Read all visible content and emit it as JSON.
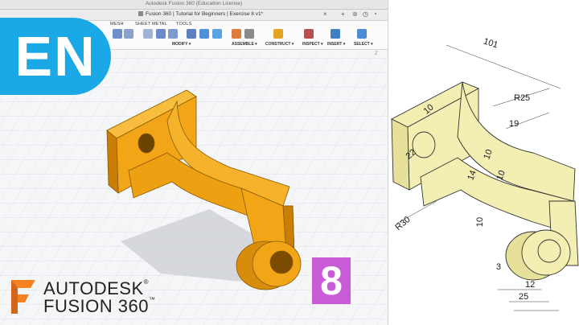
{
  "window": {
    "mac_title": "Autodesk Fusion 360 (Education License)",
    "doc_tab_title": "Fusion 360 | Tutorial for Beginners | Exercise 8 v1*"
  },
  "ribbon": {
    "tabs": [
      "MESH",
      "SHEET METAL",
      "TOOLS"
    ],
    "groups": [
      "MODIFY ▾",
      "ASSEMBLE ▾",
      "CONSTRUCT ▾",
      "INSPECT ▾",
      "INSERT ▾",
      "SELECT ▾"
    ]
  },
  "overlay": {
    "language_badge": "EN",
    "exercise_number": "8",
    "brand_line1": "AUTODESK",
    "brand_line2": "FUSION 360",
    "brand_reg": "®",
    "brand_tm": "™"
  },
  "drawing": {
    "dimensions": [
      "101",
      "R25",
      "10",
      "19",
      "22",
      "10",
      "14",
      "10",
      "R30",
      "10",
      "3",
      "12",
      "25"
    ]
  },
  "colors": {
    "part_orange": "#f2a516",
    "part_orange_dark": "#c97e05",
    "badge_blue": "#1aa8e6",
    "badge_purple": "#c85bd6",
    "drawing_fill": "#f3efb2",
    "brand_orange": "#f58220"
  }
}
